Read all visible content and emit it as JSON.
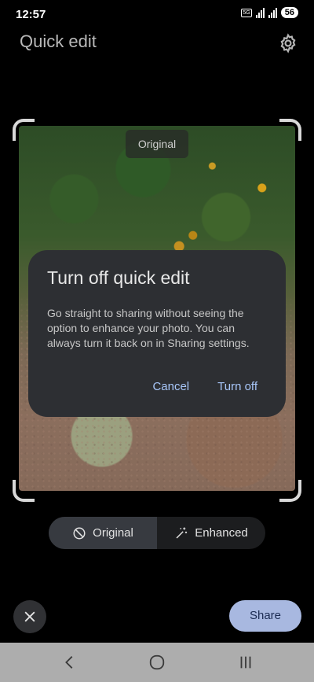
{
  "status": {
    "time": "12:57",
    "network": "5G",
    "battery": "56"
  },
  "header": {
    "title": "Quick edit",
    "settings_icon": "gear-icon"
  },
  "photo": {
    "badge": "Original"
  },
  "dialog": {
    "title": "Turn off quick edit",
    "body": "Go straight to sharing without seeing the option to enhance your photo. You can always turn it back on in Sharing settings.",
    "cancel": "Cancel",
    "confirm": "Turn off",
    "accent": "#a8c7fa"
  },
  "toggle": {
    "options": [
      {
        "label": "Original",
        "icon": "block-icon",
        "selected": true
      },
      {
        "label": "Enhanced",
        "icon": "magic-wand-icon",
        "selected": false
      }
    ]
  },
  "actions": {
    "close_icon": "close-icon",
    "share": "Share",
    "share_color": "#a8b8e0"
  },
  "navbar": {
    "back_icon": "back-icon",
    "home_icon": "home-icon",
    "recents_icon": "recents-icon"
  }
}
